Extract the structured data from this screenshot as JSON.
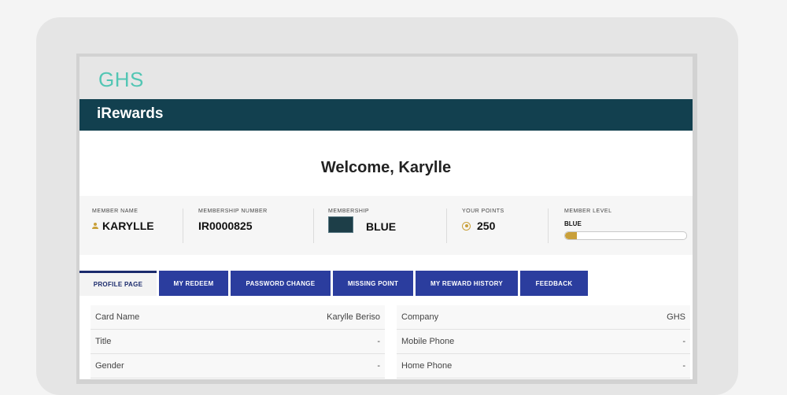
{
  "brand": {
    "logo_text": "GHS",
    "app_title": "iRewards"
  },
  "welcome": "Welcome, Karylle",
  "stats": {
    "member_name": {
      "label": "MEMBER NAME",
      "value": "KARYLLE",
      "icon": "person-icon"
    },
    "membership_number": {
      "label": "MEMBERSHIP NUMBER",
      "value": "IR0000825"
    },
    "membership": {
      "label": "MEMBERSHIP",
      "value": "BLUE",
      "icon": "card-image"
    },
    "points": {
      "label": "YOUR POINTS",
      "value": "250",
      "icon": "coin-icon"
    },
    "member_level": {
      "label": "MEMBER LEVEL",
      "value": "BLUE",
      "progress": 0.1
    }
  },
  "tabs": [
    {
      "label": "PROFILE PAGE",
      "active": true
    },
    {
      "label": "MY REDEEM",
      "active": false
    },
    {
      "label": "PASSWORD CHANGE",
      "active": false
    },
    {
      "label": "MISSING POINT",
      "active": false
    },
    {
      "label": "MY REWARD HISTORY",
      "active": false
    },
    {
      "label": "FEEDBACK",
      "active": false
    }
  ],
  "profile": {
    "left": [
      {
        "label": "Card Name",
        "value": "Karylle Beriso"
      },
      {
        "label": "Title",
        "value": "-"
      },
      {
        "label": "Gender",
        "value": "-"
      }
    ],
    "right": [
      {
        "label": "Company",
        "value": "GHS"
      },
      {
        "label": "Mobile Phone",
        "value": "-"
      },
      {
        "label": "Home Phone",
        "value": "-"
      }
    ]
  },
  "colors": {
    "navbar": "#12404f",
    "tab": "#2b3d9e",
    "logo": "#53c6b4",
    "gold": "#c9a03a"
  }
}
